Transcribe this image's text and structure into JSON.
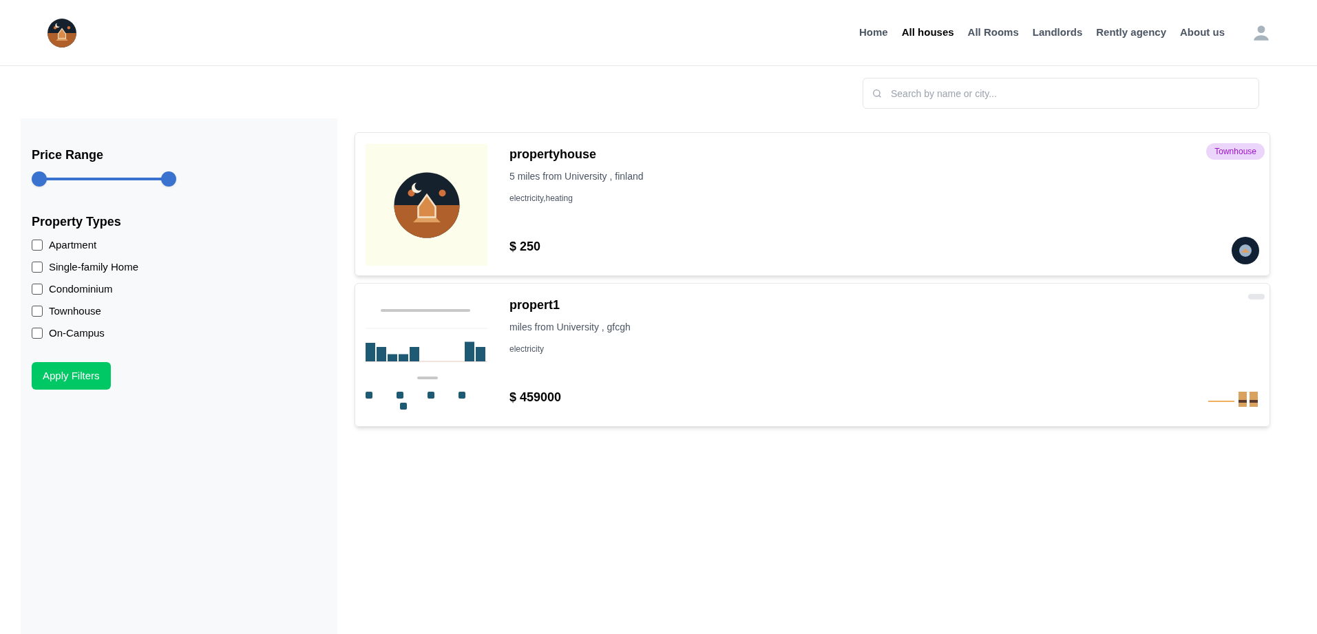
{
  "nav": {
    "items": [
      {
        "label": "Home",
        "selected": false
      },
      {
        "label": "All houses",
        "selected": true
      },
      {
        "label": "All Rooms",
        "selected": false
      },
      {
        "label": "Landlords",
        "selected": false
      },
      {
        "label": "Rently agency",
        "selected": false
      },
      {
        "label": "About us",
        "selected": false
      }
    ]
  },
  "search": {
    "placeholder": "Search by name or city..."
  },
  "filters": {
    "price_title": "Price Range",
    "price_thumbs": [
      {
        "level": 0
      },
      {
        "level": 1
      }
    ],
    "types_title": "Property Types",
    "types": [
      {
        "label": "Apartment",
        "checked": false
      },
      {
        "label": "Single-family Home",
        "checked": false
      },
      {
        "label": "Condominium",
        "checked": false
      },
      {
        "label": "Townhouse",
        "checked": false
      },
      {
        "label": "On-Campus",
        "checked": false
      }
    ],
    "apply_button": "Apply Filters"
  },
  "listings": [
    {
      "kind": "logo",
      "title": "propertyhouse",
      "location": "5 miles from University , finland",
      "amenities": "electricity,heating",
      "price": "$ 250",
      "badge": "Townhouse",
      "badge_blank": false
    },
    {
      "kind": "chart",
      "title": "propert1",
      "location": "miles from University , gfcgh",
      "amenities": "electricity",
      "price": "$ 459000",
      "badge_blank": true
    }
  ]
}
